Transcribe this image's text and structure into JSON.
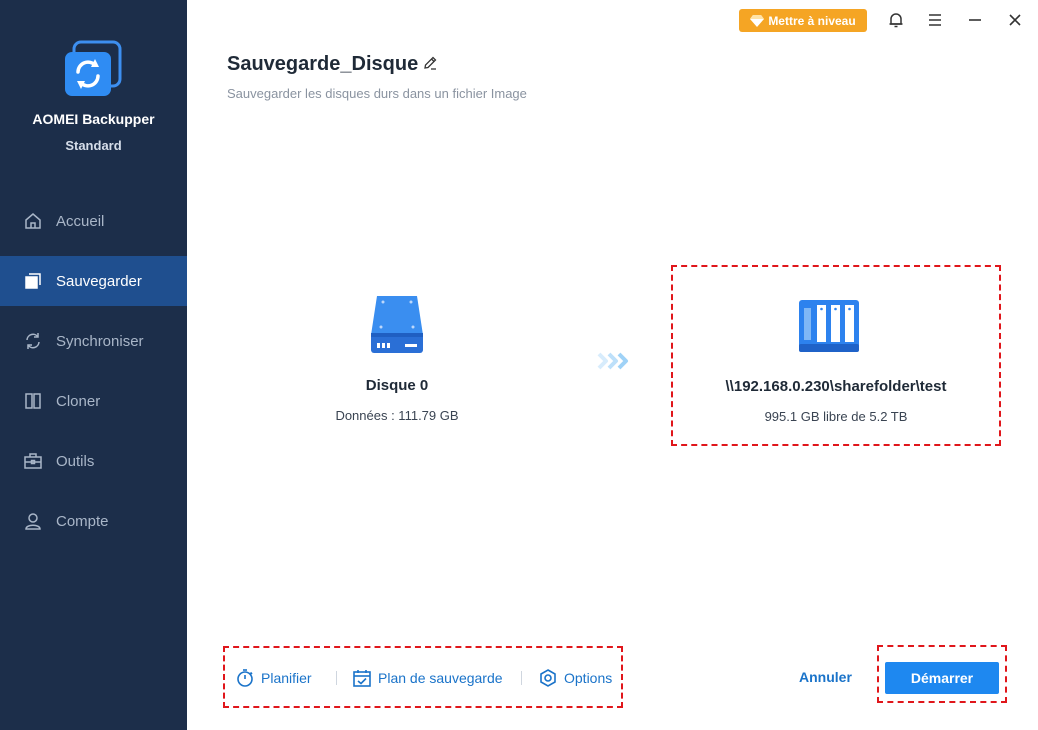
{
  "app": {
    "name": "AOMEI Backupper",
    "edition": "Standard"
  },
  "sidebar": {
    "items": [
      {
        "label": "Accueil",
        "icon": "home-icon"
      },
      {
        "label": "Sauvegarder",
        "icon": "backup-icon",
        "active": true
      },
      {
        "label": "Synchroniser",
        "icon": "sync-icon"
      },
      {
        "label": "Cloner",
        "icon": "clone-icon"
      },
      {
        "label": "Outils",
        "icon": "tools-icon"
      },
      {
        "label": "Compte",
        "icon": "account-icon"
      }
    ]
  },
  "toolbar": {
    "upgrade_label": "Mettre à niveau"
  },
  "header": {
    "title": "Sauvegarde_Disque",
    "subtitle": "Sauvegarder les disques durs dans un fichier Image"
  },
  "source": {
    "name": "Disque 0",
    "info": "Données : 111.79 GB"
  },
  "destination": {
    "path": "\\\\192.168.0.230\\sharefolder\\test",
    "info": "995.1 GB libre de 5.2 TB"
  },
  "options": {
    "schedule_label": "Planifier",
    "plan_label": "Plan de sauvegarde",
    "options_label": "Options"
  },
  "actions": {
    "cancel_label": "Annuler",
    "start_label": "Démarrer"
  },
  "colors": {
    "sidebar_bg": "#1c2e4a",
    "active_item_bg": "#1f4f8f",
    "accent": "#1e88f0",
    "upgrade": "#f5a524",
    "highlight": "#e0161b"
  }
}
